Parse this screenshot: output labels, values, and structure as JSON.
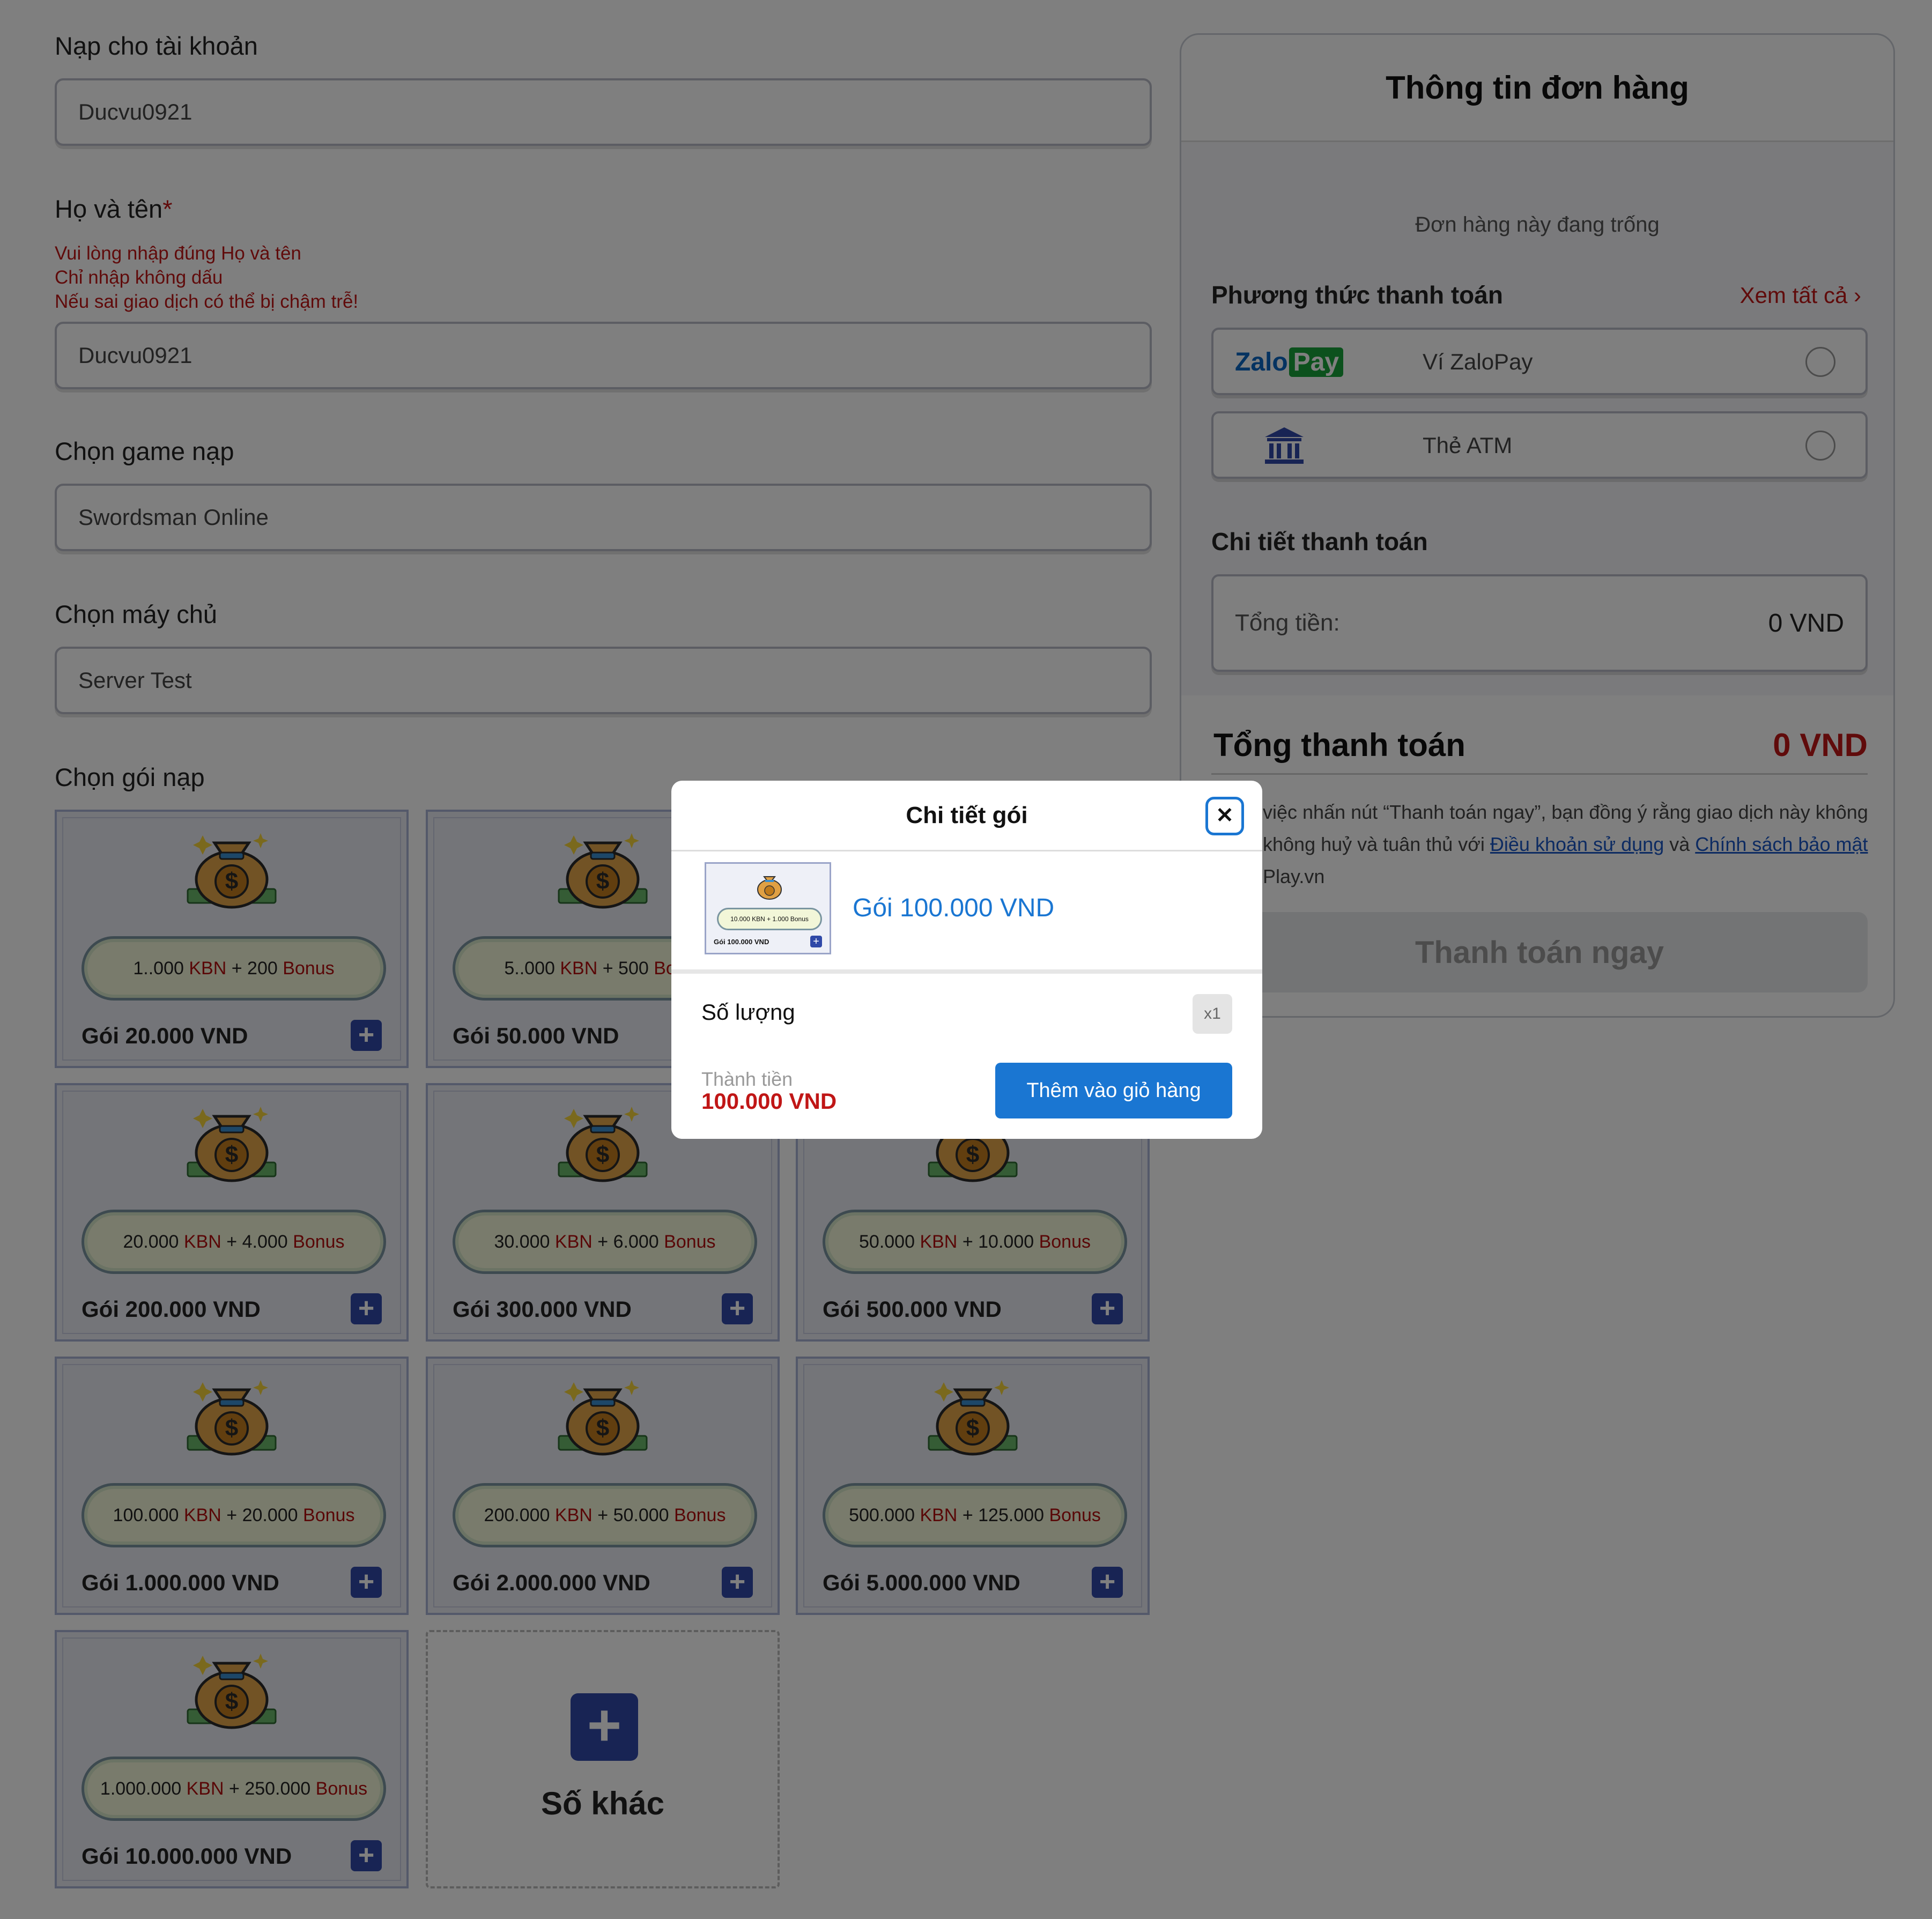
{
  "form": {
    "account_label": "Nạp cho tài khoản",
    "account_value": "Ducvu0921",
    "name_label": "Họ và tên",
    "name_required": "*",
    "name_warnings": [
      "Vui lòng nhập đúng Họ và tên",
      "Chỉ nhập không dấu",
      "Nếu sai giao dịch có thể bị chậm trễ!"
    ],
    "name_value": "Ducvu0921",
    "game_label": "Chọn game nạp",
    "game_value": "Swordsman Online",
    "server_label": "Chọn máy chủ",
    "server_value": "Server Test",
    "package_label": "Chọn gói nạp"
  },
  "packages": [
    {
      "kbn": "1..000",
      "bonus": "200",
      "name": "Gói 20.000 VND"
    },
    {
      "kbn": "5..000",
      "bonus": "500",
      "name": "Gói 50.000 VND"
    },
    {
      "kbn": "10.000",
      "bonus": "1.000",
      "name": "Gói 100.000 VND"
    },
    {
      "kbn": "20.000",
      "bonus": "4.000",
      "name": "Gói 200.000 VND"
    },
    {
      "kbn": "30.000",
      "bonus": "6.000",
      "name": "Gói 300.000 VND"
    },
    {
      "kbn": "50.000",
      "bonus": "10.000",
      "name": "Gói 500.000 VND"
    },
    {
      "kbn": "100.000",
      "bonus": "20.000",
      "name": "Gói 1.000.000 VND"
    },
    {
      "kbn": "200.000",
      "bonus": "50.000",
      "name": "Gói 2.000.000 VND"
    },
    {
      "kbn": "500.000",
      "bonus": "125.000",
      "name": "Gói 5.000.000 VND"
    },
    {
      "kbn": "1.000.000",
      "bonus": "250.000",
      "name": "Gói 10.000.000 VND"
    }
  ],
  "package_words": {
    "kbn": "KBN",
    "plus": "+",
    "bonus": "Bonus"
  },
  "other_amount": "Số khác",
  "order": {
    "title": "Thông tin đơn hàng",
    "empty": "Đơn hàng này đang trống",
    "payment_methods_label": "Phương thức thanh toán",
    "see_all": "Xem tất cả",
    "zalopay_logo": [
      "Zalo",
      "Pay"
    ],
    "zalopay_label": "Ví ZaloPay",
    "atm_label": "Thẻ ATM",
    "details_label": "Chi tiết thanh toán",
    "total_label": "Tổng tiền:",
    "total_value": "0 VND",
    "grand_label": "Tổng thanh toán",
    "grand_value": "0 VND",
    "terms_text": "việc nhấn nút “Thanh toán ngay”, bạn đồng ý rằng giao dịch này không không huỷ và tuân thủ với",
    "terms_link1": "Điều khoản sử dụng",
    "terms_and": "và",
    "terms_link2": "Chính sách bảo mật",
    "terms_tail": "Play.vn",
    "pay_button": "Thanh toán ngay"
  },
  "modal": {
    "title": "Chi tiết gói",
    "close_glyph": "✕",
    "package_name": "Gói 100.000 VND",
    "thumb_banner": "10.000 KBN + 1.000 Bonus",
    "thumb_name": "Gói 100.000 VND",
    "quantity_label": "Số lượng",
    "quantity_value": "x1",
    "subtotal_label": "Thành tiền",
    "subtotal_value": "100.000 VND",
    "add_button": "Thêm vào giỏ hàng"
  },
  "colors": {
    "accent": "#1a76d2",
    "danger": "#c01616",
    "package_blue": "#3049a8"
  }
}
